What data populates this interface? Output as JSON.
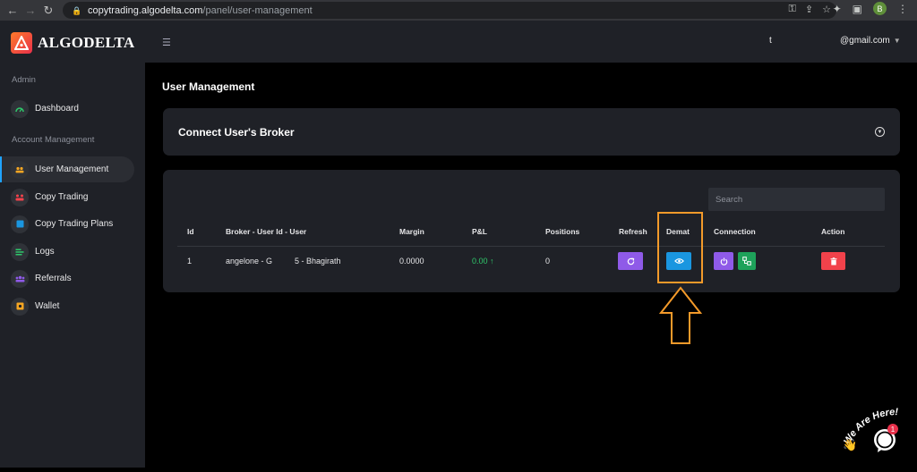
{
  "browser": {
    "url_domain": "copytrading.algodelta.com",
    "url_path": "/panel/user-management",
    "profile_initial": "B"
  },
  "brand": {
    "name": "ALGODELTA"
  },
  "sidebar": {
    "sections": [
      {
        "label": "Admin"
      },
      {
        "label": "Account Management"
      }
    ],
    "items": [
      {
        "label": "Dashboard",
        "icon": "gauge-icon",
        "color": "#2fc86b"
      },
      {
        "label": "User Management",
        "icon": "users-icon",
        "color": "#f5a623",
        "active": true
      },
      {
        "label": "Copy Trading",
        "icon": "copy-trading-icon",
        "color": "#f2424b"
      },
      {
        "label": "Copy Trading Plans",
        "icon": "plans-icon",
        "color": "#1a96e0"
      },
      {
        "label": "Logs",
        "icon": "logs-icon",
        "color": "#2fc86b"
      },
      {
        "label": "Referrals",
        "icon": "referrals-icon",
        "color": "#8f5ae8"
      },
      {
        "label": "Wallet",
        "icon": "wallet-icon",
        "color": "#f5a623"
      }
    ]
  },
  "topbar": {
    "user_partial": "t",
    "email": "@gmail.com"
  },
  "page": {
    "title": "User Management"
  },
  "connect_card": {
    "title": "Connect User's Broker"
  },
  "table": {
    "search_placeholder": "Search",
    "headers": {
      "id": "Id",
      "broker": "Broker - User Id - User",
      "margin": "Margin",
      "pnl": "P&L",
      "positions": "Positions",
      "refresh": "Refresh",
      "demat": "Demat",
      "connection": "Connection",
      "action": "Action"
    },
    "rows": [
      {
        "id": "1",
        "broker_a": "angelone - G",
        "broker_b": "5 - Bhagirath",
        "margin": "0.0000",
        "pnl": "0.00 ↑",
        "positions": "0"
      }
    ]
  },
  "chat": {
    "banner": "We Are Here!",
    "badge": "1"
  },
  "colors": {
    "accent_blue": "#1a96e0",
    "accent_purple": "#8f5ae8",
    "accent_green": "#1ea25a",
    "accent_red": "#f2424b",
    "highlight_orange": "#f39a2a"
  }
}
